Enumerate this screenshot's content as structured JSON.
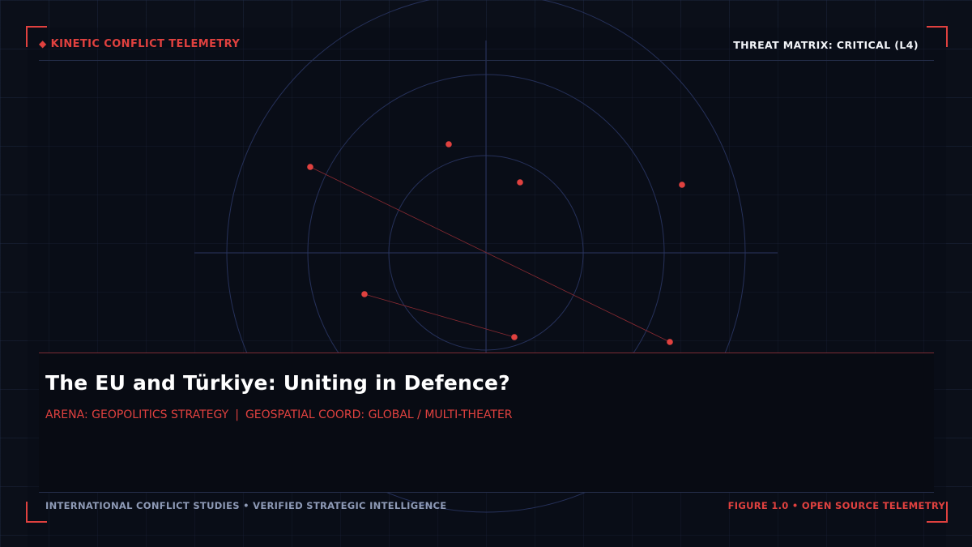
{
  "header": {
    "marker_icon": "diamond-icon",
    "section_label": "KINETIC CONFLICT TELEMETRY",
    "threat_status": "THREAT MATRIX: CRITICAL (L4)"
  },
  "content": {
    "title": "The EU and Türkiye: Uniting in Defence?",
    "arena": "ARENA: GEOPOLITICS STRATEGY",
    "separator": "|",
    "coordinates": "GEOSPATIAL COORD: GLOBAL / MULTI-THEATER"
  },
  "footer": {
    "source": "INTERNATIONAL CONFLICT STUDIES • VERIFIED STRATEGIC INTELLIGENCE",
    "figure": "FIGURE 1.0 • OPEN SOURCE TELEMETRY"
  },
  "colors": {
    "background": "#0b0f19",
    "accent": "#e0413f",
    "grid": "#1b2438",
    "radar_ring": "#26315a",
    "title_text": "#ffffff",
    "muted_text": "#8e9ab6"
  }
}
